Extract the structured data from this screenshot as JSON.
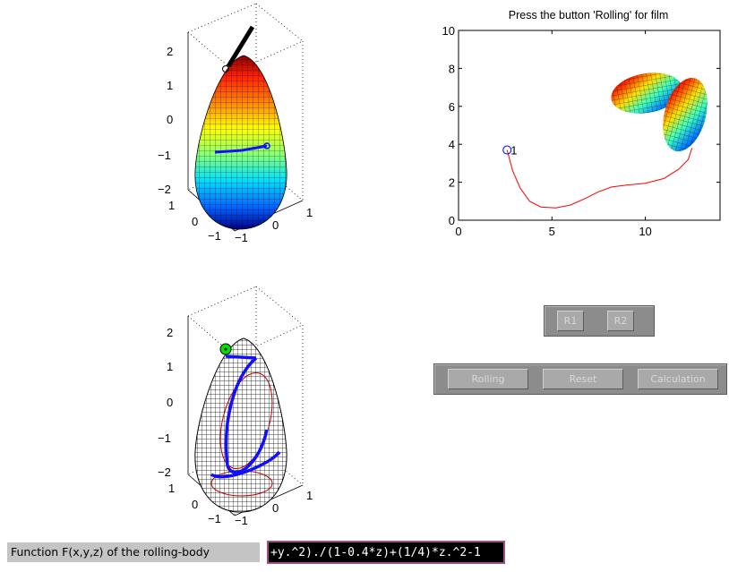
{
  "top_left_plot": {
    "z_ticks": [
      "2",
      "1",
      "0",
      "−1",
      "−2"
    ],
    "y_ticks": [
      "1",
      "0",
      "−1"
    ],
    "x_ticks": [
      "−1",
      "0",
      "1"
    ]
  },
  "bottom_left_plot": {
    "z_ticks": [
      "2",
      "1",
      "0",
      "−1",
      "−2"
    ],
    "y_ticks": [
      "1",
      "0",
      "−1"
    ],
    "x_ticks": [
      "−1",
      "0",
      "1"
    ]
  },
  "chart_data": {
    "type": "line",
    "title": "Press the button 'Rolling' for film",
    "xlim": [
      0,
      14
    ],
    "ylim": [
      0,
      10
    ],
    "x_ticks": [
      "0",
      "5",
      "10"
    ],
    "y_ticks": [
      "0",
      "2",
      "4",
      "6",
      "8",
      "10"
    ],
    "grid": false,
    "series": [
      {
        "x": [
          2.6,
          2.9,
          3.3,
          3.8,
          4.4,
          5.2,
          6.0,
          6.8,
          7.5,
          8.2,
          9.0,
          10.0,
          11.0,
          11.8,
          12.3,
          12.5
        ],
        "y": [
          3.7,
          2.6,
          1.7,
          1.0,
          0.7,
          0.65,
          0.8,
          1.15,
          1.5,
          1.75,
          1.85,
          1.95,
          2.2,
          2.7,
          3.2,
          3.8
        ],
        "color": "#ff0000"
      }
    ],
    "start_marker": {
      "x": 2.6,
      "y": 3.7,
      "label": "1",
      "color": "#0000ff"
    }
  },
  "controls": {
    "r1_label": "R1",
    "r2_label": "R2",
    "rolling_label": "Rolling",
    "reset_label": "Reset",
    "calculation_label": "Calculation"
  },
  "function": {
    "label": "Function F(x,y,z) of the rolling-body",
    "value": "+y.^2)./(1-0.4*z)+(1/4)*z.^2-1"
  },
  "colors": {
    "panel_bg": "#8c8c8c",
    "button_bg": "#a9a9a9",
    "input_border": "#a34d8a",
    "path_color": "#ff0000",
    "marker_color": "#0000ff",
    "contact_marker": "#00e000"
  }
}
